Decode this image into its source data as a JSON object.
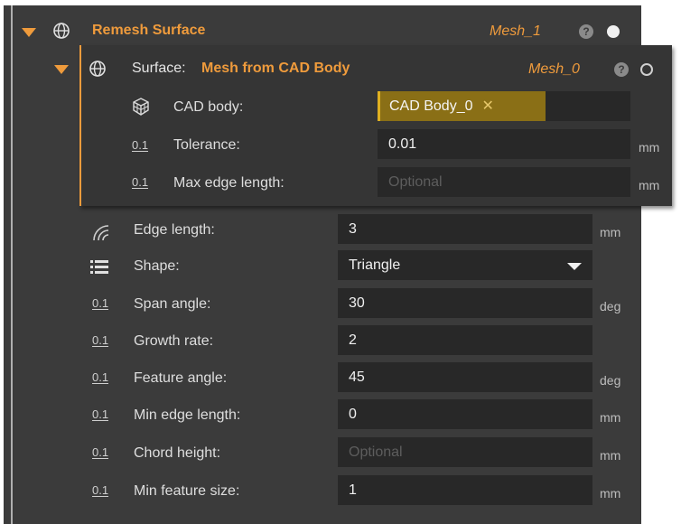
{
  "remesh": {
    "title": "Remesh Surface",
    "mesh_name": "Mesh_1",
    "help": "?"
  },
  "surface": {
    "label": "Surface:",
    "value": "Mesh from CAD Body",
    "mesh_name": "Mesh_0",
    "help": "?",
    "cad_body": {
      "label": "CAD body:",
      "tag": "CAD Body_0",
      "remove": "✕"
    },
    "tolerance": {
      "prefix": "0.1",
      "label": "Tolerance:",
      "value": "0.01",
      "unit": "mm"
    },
    "max_edge_length": {
      "prefix": "0.1",
      "label": "Max edge length:",
      "placeholder": "Optional",
      "unit": "mm"
    }
  },
  "params": {
    "edge_length": {
      "label": "Edge length:",
      "value": "3",
      "unit": "mm"
    },
    "shape": {
      "label": "Shape:",
      "value": "Triangle"
    },
    "span_angle": {
      "prefix": "0.1",
      "label": "Span angle:",
      "value": "30",
      "unit": "deg"
    },
    "growth_rate": {
      "prefix": "0.1",
      "label": "Growth rate:",
      "value": "2",
      "unit": ""
    },
    "feature_angle": {
      "prefix": "0.1",
      "label": "Feature angle:",
      "value": "45",
      "unit": "deg"
    },
    "min_edge_length": {
      "prefix": "0.1",
      "label": "Min edge length:",
      "value": "0",
      "unit": "mm"
    },
    "chord_height": {
      "prefix": "0.1",
      "label": "Chord height:",
      "placeholder": "Optional",
      "unit": "mm"
    },
    "min_feature_size": {
      "prefix": "0.1",
      "label": "Min feature size:",
      "value": "1",
      "unit": "mm"
    }
  },
  "colors": {
    "accent": "#ef9b3c",
    "panel": "#3b3b3b",
    "field": "#282828",
    "tag": "#8a6f16"
  },
  "icons": [
    "caret-down-icon",
    "globe-icon",
    "help-icon",
    "status-dot-icon",
    "cube-icon",
    "decimal-icon",
    "edge-length-icon",
    "list-icon"
  ]
}
